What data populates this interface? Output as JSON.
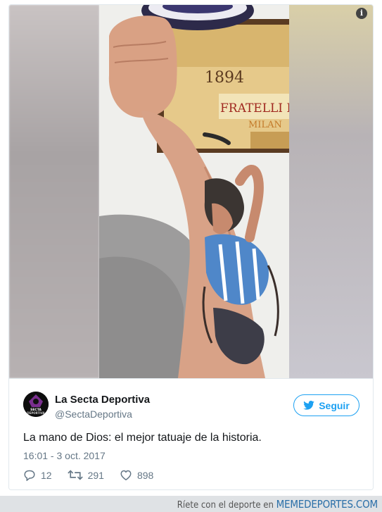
{
  "tweet": {
    "display_name": "La Secta Deportiva",
    "handle": "@SectaDeportiva",
    "follow_label": "Seguir",
    "text": "La mano de Dios: el mejor tatuaje de la historia.",
    "timestamp": "16:01 - 3 oct. 2017",
    "replies": "12",
    "retweets": "291",
    "likes": "898"
  },
  "media": {
    "sign_year": "1894",
    "sign_brand": "FRATELLI BRAN",
    "sign_city": "MILAN",
    "info_glyph": "i"
  },
  "avatar": {
    "line1": "SECTA",
    "line2": "DEPORTIVA"
  },
  "footer": {
    "prefix": "Ríete con el deporte en",
    "brand": "MEMEDEPORTES.COM"
  },
  "colors": {
    "twitter_blue": "#1da1f2",
    "secondary_text": "#657786",
    "primary_text": "#14171a",
    "footer_bg": "#dfe2e5"
  }
}
